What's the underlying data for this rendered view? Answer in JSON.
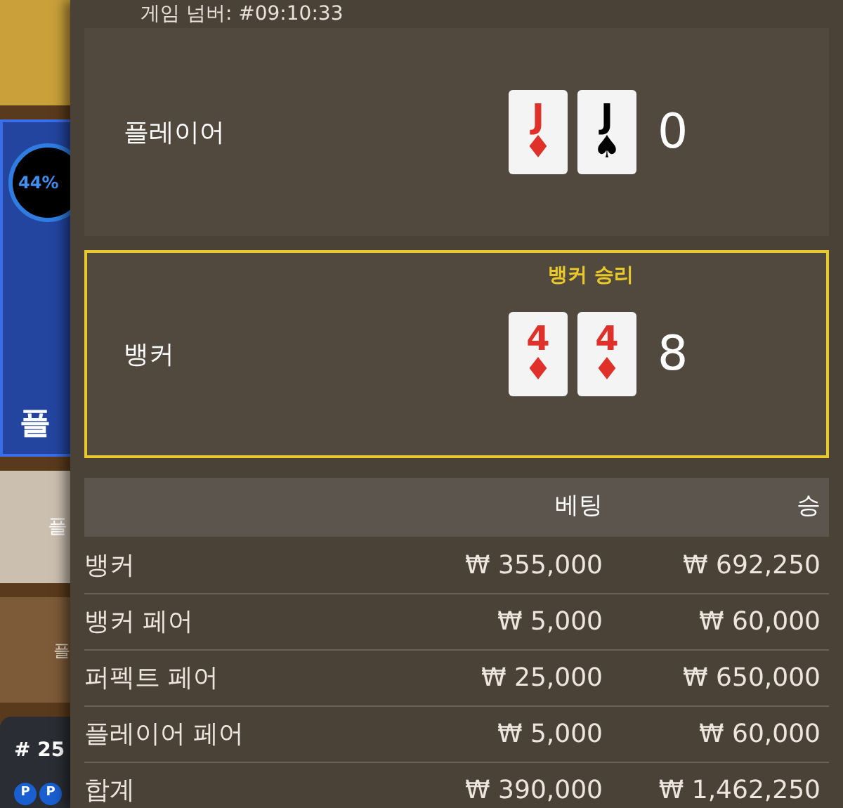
{
  "background": {
    "progress_badge": "44%",
    "tile_labels": [
      "플",
      "플",
      "플"
    ],
    "round_label": "# 25",
    "pair_markers": [
      "P",
      "P"
    ]
  },
  "game_number": "게임 넘버: #09:10:33",
  "hands": [
    {
      "name": "플레이어",
      "winner": false,
      "cards": [
        {
          "rank": "J",
          "suit": "♦",
          "color": "#e0302a"
        },
        {
          "rank": "J",
          "suit": "♠",
          "color": "#000000"
        }
      ],
      "score": "0"
    },
    {
      "name": "뱅커",
      "winner": true,
      "result": "뱅커 승리",
      "cards": [
        {
          "rank": "4",
          "suit": "♦",
          "color": "#e0302a"
        },
        {
          "rank": "4",
          "suit": "♦",
          "color": "#e0302a"
        }
      ],
      "score": "8"
    }
  ],
  "table": {
    "columns": [
      "",
      "베팅",
      "승"
    ],
    "rows": [
      [
        "뱅커",
        "₩ 355,000",
        "₩ 692,250"
      ],
      [
        "뱅커 페어",
        "₩ 5,000",
        "₩ 60,000"
      ],
      [
        "퍼펙트 페어",
        "₩ 25,000",
        "₩ 650,000"
      ],
      [
        "플레이어 페어",
        "₩ 5,000",
        "₩ 60,000"
      ],
      [
        "합계",
        "₩ 390,000",
        "₩ 1,462,250"
      ]
    ]
  }
}
